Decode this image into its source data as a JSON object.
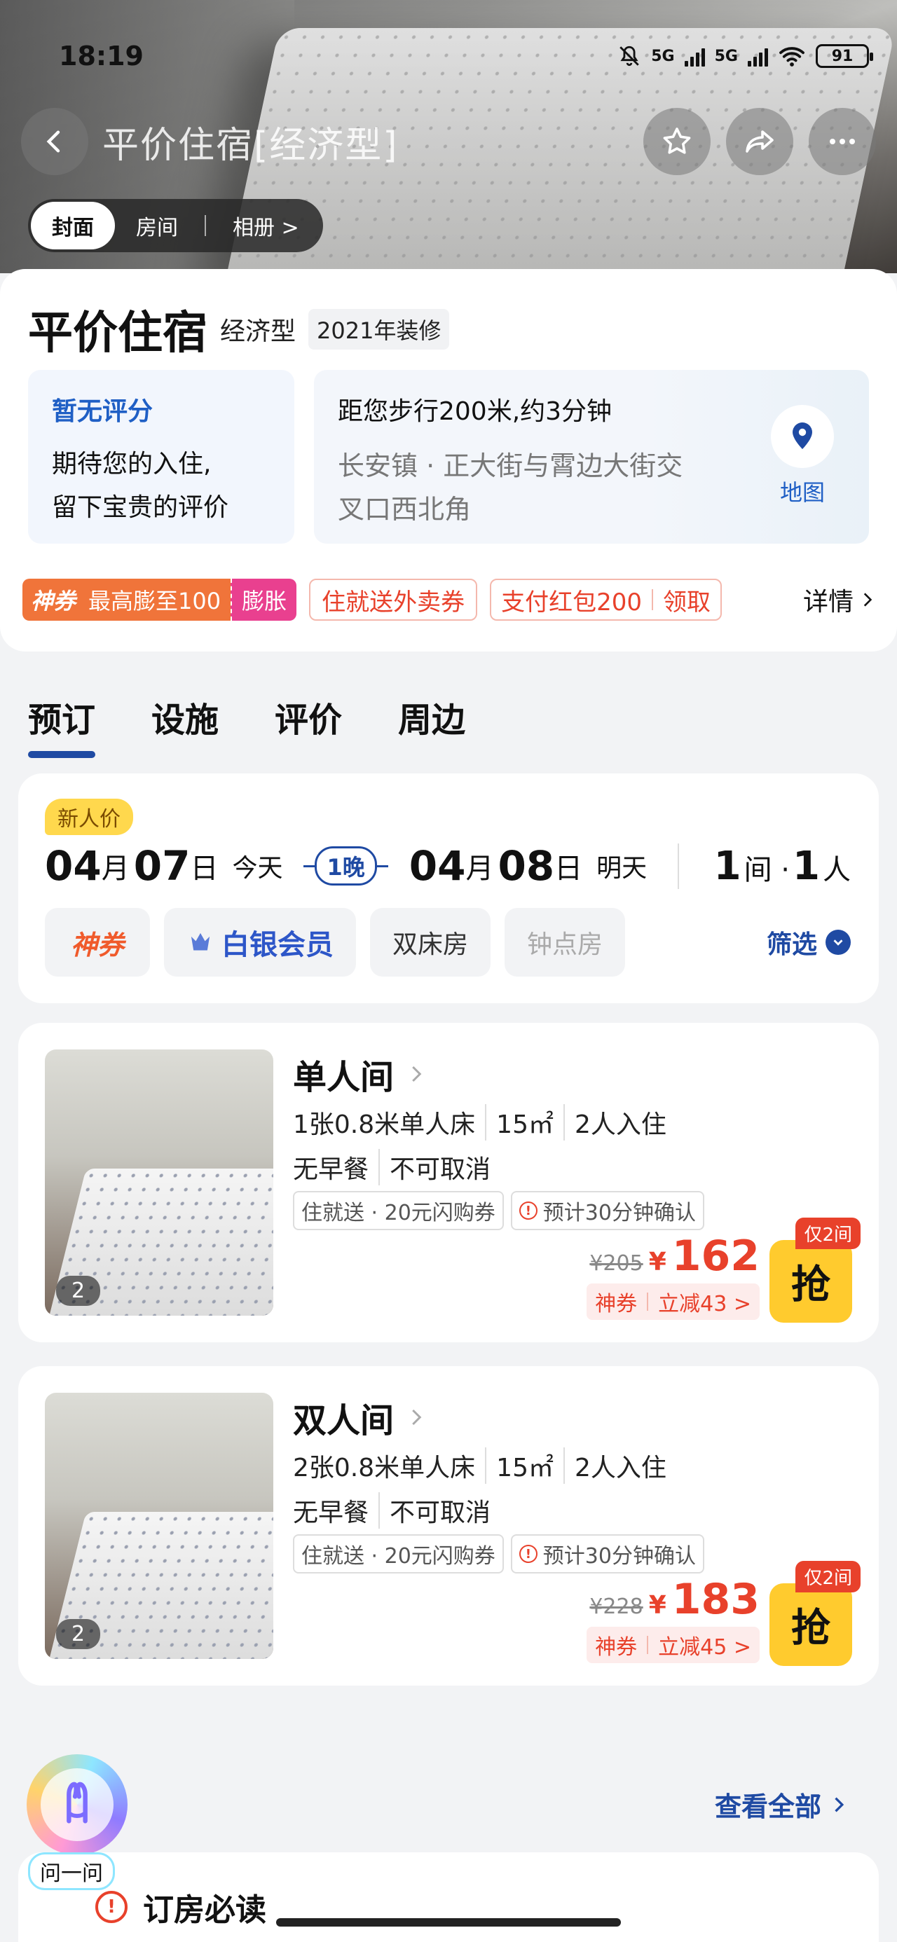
{
  "status_bar": {
    "time": "18:19",
    "network1": "5G",
    "network2": "5G",
    "battery": "91"
  },
  "nav": {
    "title": "平价住宿[经济型]"
  },
  "hero_tabs": [
    {
      "label": "封面",
      "active": true
    },
    {
      "label": "房间",
      "active": false
    },
    {
      "label": "相册 >",
      "active": false
    }
  ],
  "hotel": {
    "name": "平价住宿",
    "type": "经济型",
    "tag": "2021年装修"
  },
  "rating": {
    "title": "暂无评分",
    "line1": "期待您的入住,",
    "line2": "留下宝贵的评价"
  },
  "location": {
    "distance": "距您步行200米,约3分钟",
    "address_line1": "长安镇 · 正大街与霄边大街交",
    "address_line2": "叉口西北角",
    "map_label": "地图"
  },
  "coupons": {
    "shenquan": "神券",
    "max": "最高膨至100",
    "expand": "膨胀",
    "delivery": "住就送外卖券",
    "redpacket": "支付红包200",
    "claim": "领取",
    "details": "详情"
  },
  "section_tabs": [
    "预订",
    "设施",
    "评价",
    "周边"
  ],
  "booking": {
    "new_badge": "新人价",
    "checkin": {
      "month": "04",
      "day": "07",
      "m_unit": "月",
      "d_unit": "日",
      "label": "今天"
    },
    "nights": "1晚",
    "checkout": {
      "month": "04",
      "day": "08",
      "m_unit": "月",
      "d_unit": "日",
      "label": "明天"
    },
    "rooms": "1",
    "rooms_unit": "间 ·",
    "people": "1",
    "people_unit": "人",
    "filters": {
      "shenquan": "神券",
      "silver": "白银会员",
      "twin": "双床房",
      "hourly": "钟点房",
      "filter_btn": "筛选"
    }
  },
  "rooms": [
    {
      "name": "单人间",
      "specs": [
        "1张0.8米单人床",
        "15㎡",
        "2人入住"
      ],
      "policy": [
        "无早餐",
        "不可取消"
      ],
      "tag1": "住就送 · 20元闪购券",
      "tag2": "预计30分钟确认",
      "old_price": "¥205",
      "currency": "¥",
      "price": "162",
      "disc_label": "神券",
      "disc_value": "立减43 >",
      "grab": "抢",
      "only": "仅2间",
      "photo_count": "2"
    },
    {
      "name": "双人间",
      "specs": [
        "2张0.8米单人床",
        "15㎡",
        "2人入住"
      ],
      "policy": [
        "无早餐",
        "不可取消"
      ],
      "tag1": "住就送 · 20元闪购券",
      "tag2": "预计30分钟确认",
      "old_price": "¥228",
      "currency": "¥",
      "price": "183",
      "disc_label": "神券",
      "disc_value": "立减45 >",
      "grab": "抢",
      "only": "仅2间",
      "photo_count": "2"
    }
  ],
  "view_all": "查看全部",
  "notice": {
    "title": "订房必读"
  },
  "assistant": {
    "label": "问一问"
  },
  "colors": {
    "brand_blue": "#1f4aa3",
    "price_red": "#e8412b",
    "grab_yellow": "#ffcb2e"
  }
}
